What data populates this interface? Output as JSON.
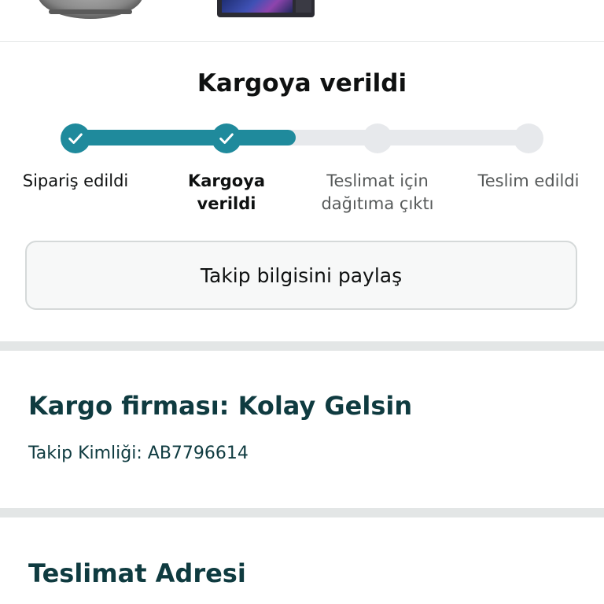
{
  "products": {
    "items": [
      {
        "icon": "smart-speaker-image"
      },
      {
        "icon": "smart-display-image"
      }
    ]
  },
  "status": {
    "title": "Kargoya verildi",
    "progress_fraction": 0.5,
    "accent_color": "#1f8a9c",
    "steps": [
      {
        "label": "Sipariş edildi",
        "state": "done"
      },
      {
        "label": "Kargoya verildi",
        "state": "current"
      },
      {
        "label": "Teslimat için dağıtıma çıktı",
        "state": "pending"
      },
      {
        "label": "Teslim edildi",
        "state": "pending"
      }
    ]
  },
  "share": {
    "label": "Takip bilgisini paylaş"
  },
  "carrier": {
    "title": "Kargo firması: Kolay Gelsin",
    "tracking_id": "Takip Kimliği: AB7796614"
  },
  "address": {
    "title": "Teslimat Adresi"
  }
}
